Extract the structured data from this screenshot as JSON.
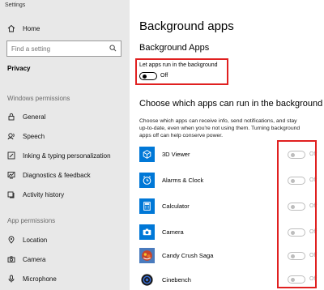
{
  "window": {
    "title": "Settings"
  },
  "sidebar": {
    "home_label": "Home",
    "search_placeholder": "Find a setting",
    "category": "Privacy",
    "windows_permissions_header": "Windows permissions",
    "windows_permissions": [
      {
        "label": "General",
        "icon": "lock-icon"
      },
      {
        "label": "Speech",
        "icon": "speech-icon"
      },
      {
        "label": "Inking & typing personalization",
        "icon": "inking-icon"
      },
      {
        "label": "Diagnostics & feedback",
        "icon": "diagnostics-icon"
      },
      {
        "label": "Activity history",
        "icon": "activity-history-icon"
      }
    ],
    "app_permissions_header": "App permissions",
    "app_permissions": [
      {
        "label": "Location",
        "icon": "location-icon"
      },
      {
        "label": "Camera",
        "icon": "camera-icon"
      },
      {
        "label": "Microphone",
        "icon": "microphone-icon"
      }
    ]
  },
  "main": {
    "page_title": "Background apps",
    "section_title": "Background Apps",
    "master_toggle": {
      "label": "Let apps run in the background",
      "state": "Off"
    },
    "choose_title": "Choose which apps can run in the background",
    "description": "Choose which apps can receive info, send notifications, and stay up-to-date, even when you're not using them. Turning background apps off can help conserve power.",
    "apps": [
      {
        "name": "3D Viewer",
        "state": "Off",
        "icon": "3d-viewer-icon",
        "color": "#0078d7"
      },
      {
        "name": "Alarms & Clock",
        "state": "Off",
        "icon": "alarm-clock-icon",
        "color": "#0078d7"
      },
      {
        "name": "Calculator",
        "state": "Off",
        "icon": "calculator-icon",
        "color": "#0078d7"
      },
      {
        "name": "Camera",
        "state": "Off",
        "icon": "camera-app-icon",
        "color": "#0078d7"
      },
      {
        "name": "Candy Crush Saga",
        "state": "Off",
        "icon": "candy-crush-icon",
        "color": "#c7442a"
      },
      {
        "name": "Cinebench",
        "state": "Off",
        "icon": "cinebench-icon",
        "color": "#1a1a1a"
      }
    ]
  },
  "colors": {
    "sidebar_bg": "#e8e8e8",
    "accent": "#0078d7",
    "highlight": "#e02020"
  }
}
